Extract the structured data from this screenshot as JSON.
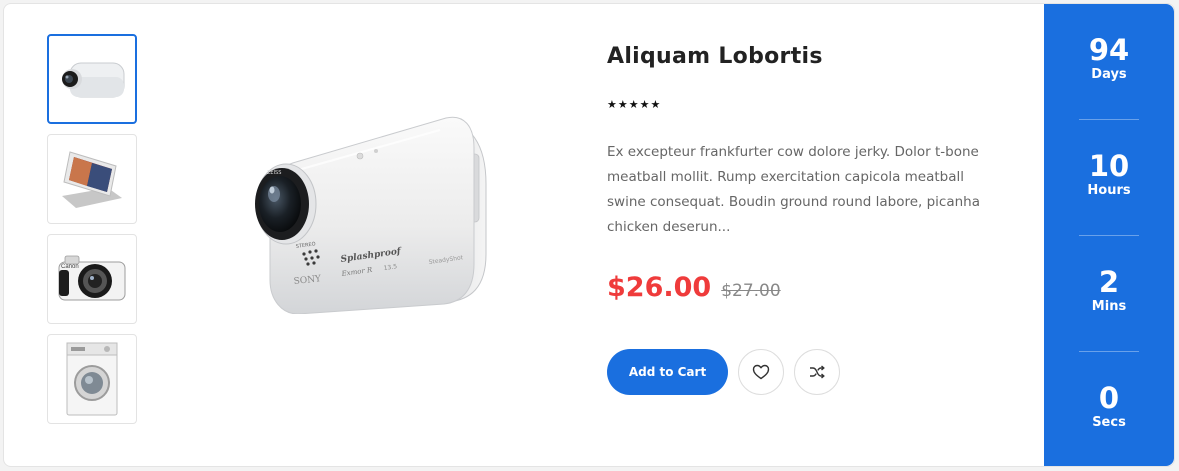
{
  "product": {
    "title": "Aliquam Lobortis",
    "rating": 5,
    "description": "Ex excepteur frankfurter cow dolore jerky. Dolor t-bone meatball mollit. Rump exercitation capicola meatball swine consequat. Boudin ground round labore, picanha chicken deserun...",
    "price": "$26.00",
    "old_price": "$27.00",
    "main_image": "action-camera",
    "camera_text": {
      "model": "Splashproof",
      "brand": "SONY",
      "line": "Exmor R",
      "zeiss": "ZEISS",
      "stereo": "STEREO",
      "steady": "SteadyShot",
      "f_number": "13.5"
    }
  },
  "thumbnails": [
    {
      "image": "action-camera",
      "active": true
    },
    {
      "image": "tablet-on-stand",
      "active": false
    },
    {
      "image": "mirrorless-camera",
      "active": false,
      "brand": "Canon"
    },
    {
      "image": "washing-machine",
      "active": false
    }
  ],
  "actions": {
    "add_to_cart_label": "Add to Cart",
    "wishlist_icon": "heart-icon",
    "compare_icon": "shuffle-icon"
  },
  "countdown": [
    {
      "value": "94",
      "label": "Days"
    },
    {
      "value": "10",
      "label": "Hours"
    },
    {
      "value": "2",
      "label": "Mins"
    },
    {
      "value": "0",
      "label": "Secs"
    }
  ],
  "colors": {
    "accent": "#1a6fdf",
    "price": "#ef3b3b",
    "old_price": "#888888"
  }
}
